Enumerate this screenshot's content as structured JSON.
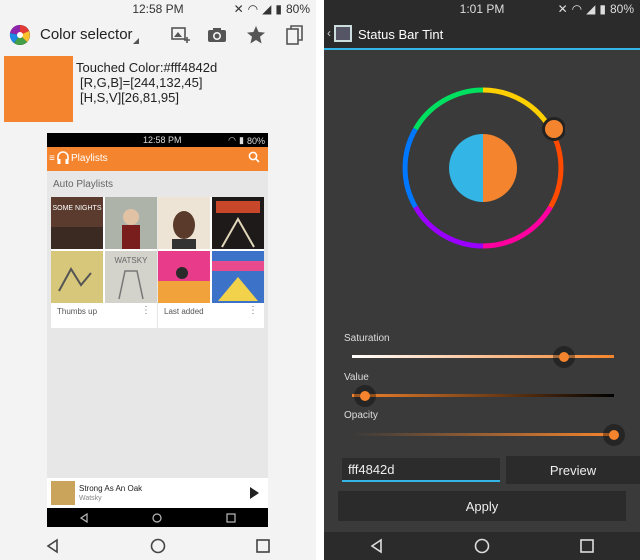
{
  "left": {
    "status": {
      "time": "12:58 PM",
      "battery": "80%"
    },
    "app_title": "Color selector",
    "touched": {
      "line1": "Touched Color:#fff4842d",
      "line2": "[R,G,B]=[244,132,45]",
      "line3": "[H,S,V][26,81,95]",
      "color": "#f4842d"
    },
    "phone": {
      "status": {
        "time": "12:58 PM",
        "battery": "80%"
      },
      "title": "Playlists",
      "section": "Auto Playlists",
      "cards": [
        {
          "label": "Thumbs up"
        },
        {
          "label": "Last added"
        }
      ],
      "album_texts": [
        "SOME NIGHTS",
        "WATSKY"
      ],
      "now_playing": {
        "title": "Strong As An Oak",
        "artist": "Watsky"
      }
    }
  },
  "right": {
    "status": {
      "time": "1:01 PM",
      "battery": "80%"
    },
    "app_title": "Status Bar Tint",
    "sliders": [
      {
        "label": "Saturation",
        "value": 0.81
      },
      {
        "label": "Value",
        "value": 0.05
      },
      {
        "label": "Opacity",
        "value": 1.0
      }
    ],
    "hex_value": "fff4842d",
    "preview_label": "Preview",
    "apply_label": "Apply",
    "accent": "#33b5e5",
    "selected_color": "#f4842d",
    "original_color": "#33b5e5"
  }
}
